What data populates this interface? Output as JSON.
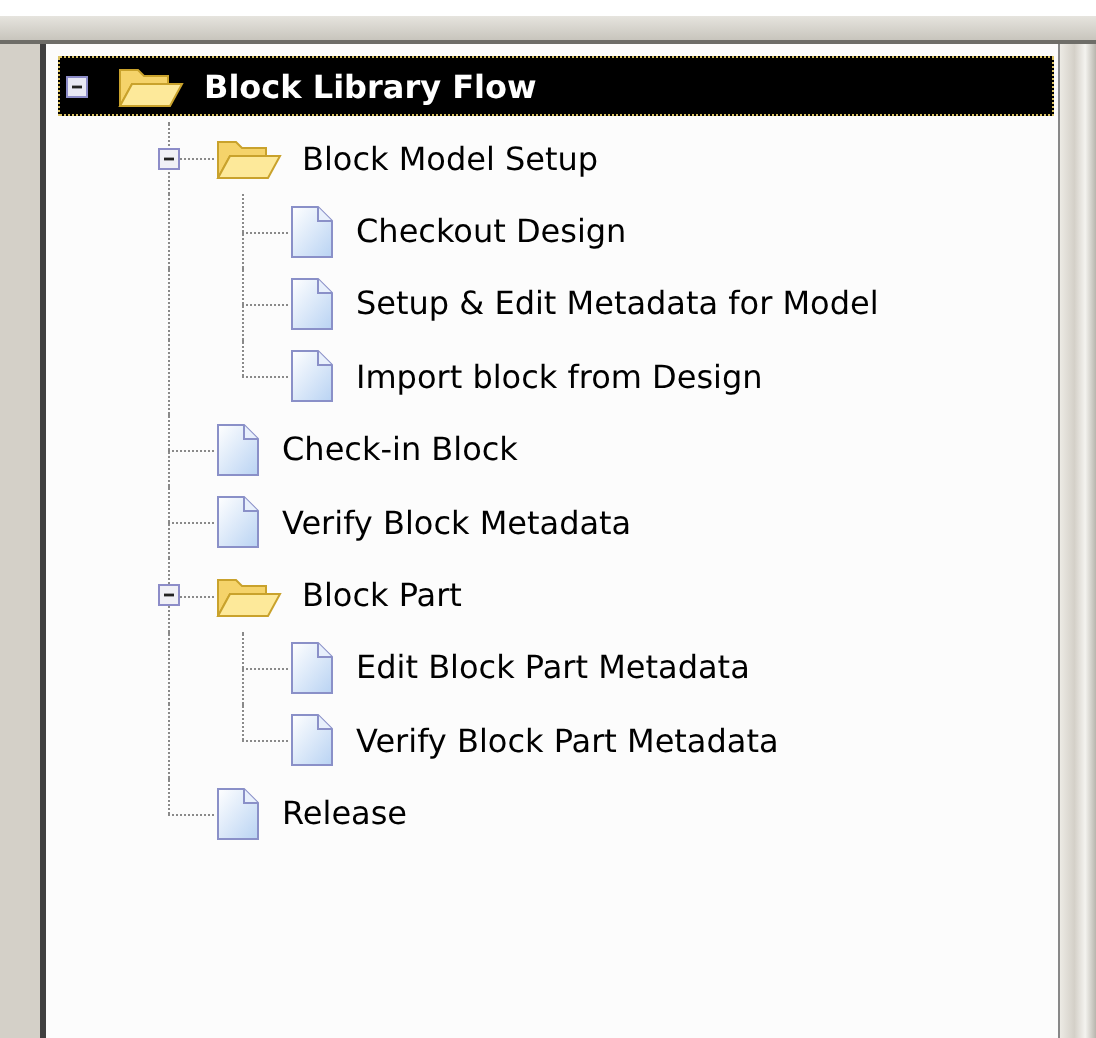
{
  "tree": [
    {
      "label": "Block Library Flow",
      "kind": "folder",
      "expanded": true,
      "selected": true,
      "children": [
        {
          "label": "Block Model Setup",
          "kind": "folder",
          "expanded": true,
          "selected": false,
          "children": [
            {
              "label": "Checkout Design",
              "kind": "document",
              "selected": false
            },
            {
              "label": "Setup & Edit Metadata for Model",
              "kind": "document",
              "selected": false
            },
            {
              "label": "Import block from Design",
              "kind": "document",
              "selected": false
            }
          ]
        },
        {
          "label": "Check-in Block",
          "kind": "document",
          "selected": false
        },
        {
          "label": "Verify Block Metadata",
          "kind": "document",
          "selected": false
        },
        {
          "label": "Block Part",
          "kind": "folder",
          "expanded": true,
          "selected": false,
          "children": [
            {
              "label": "Edit Block Part Metadata",
              "kind": "document",
              "selected": false
            },
            {
              "label": "Verify Block Part Metadata",
              "kind": "document",
              "selected": false
            }
          ]
        },
        {
          "label": "Release",
          "kind": "document",
          "selected": false
        }
      ]
    }
  ]
}
